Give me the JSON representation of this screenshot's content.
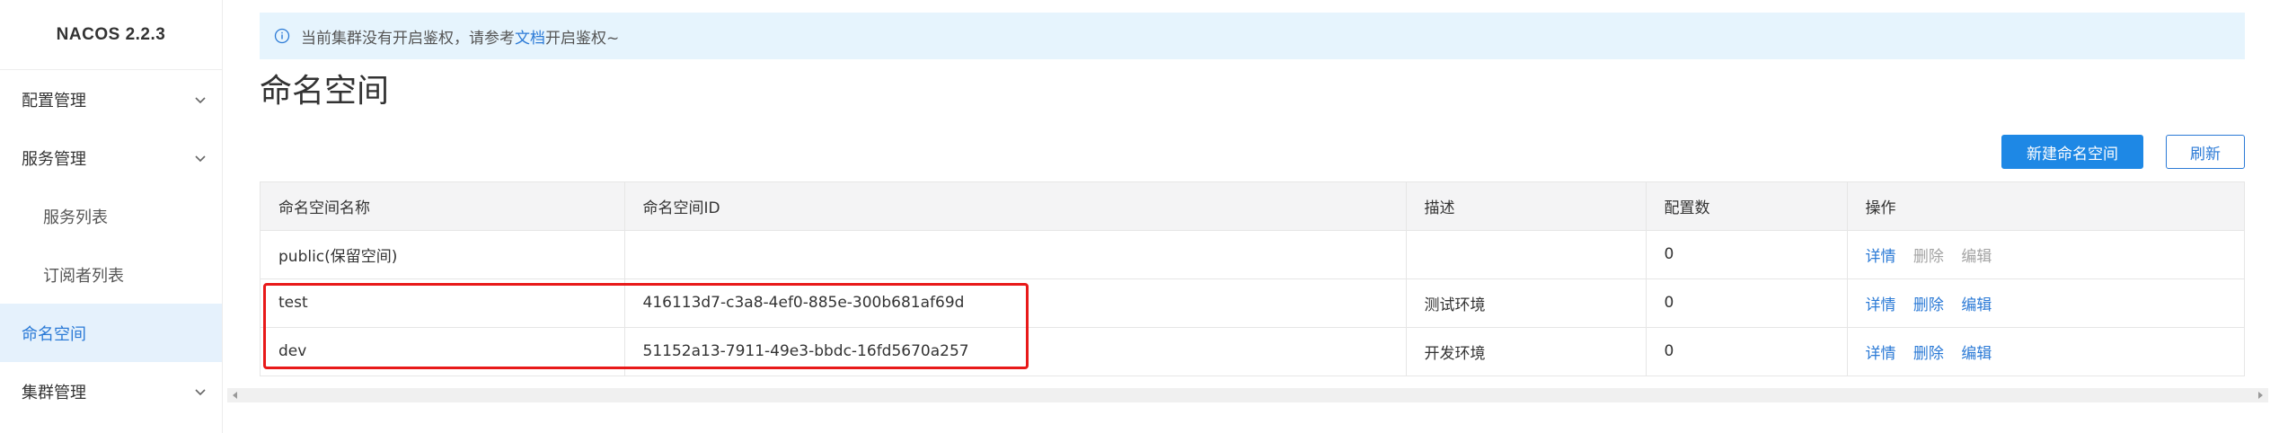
{
  "brand": "NACOS 2.2.3",
  "sidebar": {
    "items": [
      {
        "label": "配置管理"
      },
      {
        "label": "服务管理"
      },
      {
        "label": "服务列表"
      },
      {
        "label": "订阅者列表"
      },
      {
        "label": "命名空间"
      },
      {
        "label": "集群管理"
      }
    ]
  },
  "alert": {
    "text_before": "当前集群没有开启鉴权，请参考",
    "link": "文档",
    "text_after": "开启鉴权~"
  },
  "page": {
    "title": "命名空间"
  },
  "toolbar": {
    "create_label": "新建命名空间",
    "refresh_label": "刷新"
  },
  "table": {
    "headers": [
      "命名空间名称",
      "命名空间ID",
      "描述",
      "配置数",
      "操作"
    ],
    "rows": [
      {
        "name": "public(保留空间)",
        "id": "",
        "desc": "",
        "count": "0",
        "ops": {
          "detail": "详情",
          "delete": "删除",
          "edit": "编辑"
        }
      },
      {
        "name": "test",
        "id": "416113d7-c3a8-4ef0-885e-300b681af69d",
        "desc": "测试环境",
        "count": "0",
        "ops": {
          "detail": "详情",
          "delete": "删除",
          "edit": "编辑"
        }
      },
      {
        "name": "dev",
        "id": "51152a13-7911-49e3-bbdc-16fd5670a257",
        "desc": "开发环境",
        "count": "0",
        "ops": {
          "detail": "详情",
          "delete": "删除",
          "edit": "编辑"
        }
      }
    ]
  },
  "colors": {
    "accent": "#1e88e5",
    "link": "#2b7ad6",
    "highlight": "#e81919",
    "alert_bg": "#e6f4fd"
  }
}
